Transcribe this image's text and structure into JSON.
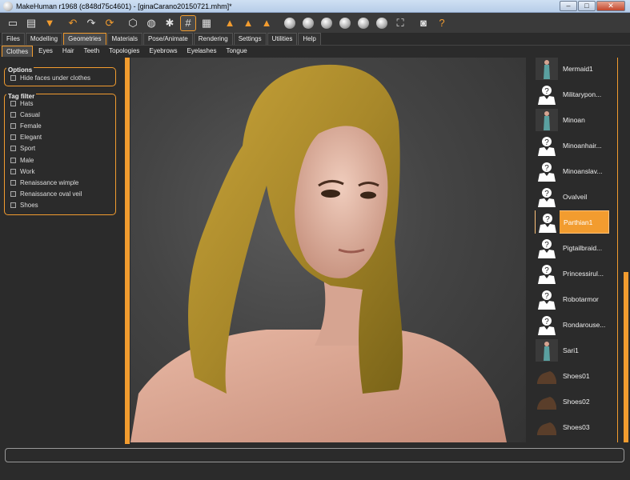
{
  "window": {
    "title": "MakeHuman r1968 (c848d75c4601) - [ginaCarano20150721.mhm]*",
    "minimize": "‒",
    "maximize": "□",
    "close": "✕"
  },
  "toolbar": {
    "icons": [
      "undo-icon",
      "redo-icon",
      "reset-icon",
      "wireframe-icon",
      "smooth-icon",
      "pose-icon",
      "grid-icon",
      "checker-icon",
      "front-view-icon",
      "back-view-icon",
      "left-view-icon",
      "right-view-icon",
      "top-view-icon",
      "bottom-view-icon",
      "reset-camera-icon",
      "screenshot-icon",
      "help-icon"
    ],
    "help_label": "?"
  },
  "menu_tabs": [
    "Files",
    "Modelling",
    "Geometries",
    "Materials",
    "Pose/Animate",
    "Rendering",
    "Settings",
    "Utilities",
    "Help"
  ],
  "active_menu_tab": "Geometries",
  "sub_tabs": [
    "Clothes",
    "Eyes",
    "Hair",
    "Teeth",
    "Topologies",
    "Eyebrows",
    "Eyelashes",
    "Tongue"
  ],
  "active_sub_tab": "Clothes",
  "options": {
    "title": "Options",
    "hide_faces": "Hide faces under clothes"
  },
  "tag_filter": {
    "title": "Tag filter",
    "tags": [
      "Hats",
      "Casual",
      "Female",
      "Elegant",
      "Sport",
      "Male",
      "Work",
      "Renaissance wimple",
      "Renaissance oval veil",
      "Shoes"
    ]
  },
  "clothes_list": [
    {
      "label": "Mermaid1",
      "thumb": "figure"
    },
    {
      "label": "Militarypon...",
      "thumb": "placeholder"
    },
    {
      "label": "Minoan",
      "thumb": "figure"
    },
    {
      "label": "Minoanhair...",
      "thumb": "placeholder"
    },
    {
      "label": "Minoanslav...",
      "thumb": "placeholder"
    },
    {
      "label": "Ovalveil",
      "thumb": "placeholder"
    },
    {
      "label": "Parthian1",
      "thumb": "placeholder",
      "selected": true
    },
    {
      "label": "Pigtailbraid...",
      "thumb": "placeholder"
    },
    {
      "label": "Princessirul...",
      "thumb": "placeholder"
    },
    {
      "label": "Robotarmor",
      "thumb": "placeholder"
    },
    {
      "label": "Rondarouse...",
      "thumb": "placeholder"
    },
    {
      "label": "Sari1",
      "thumb": "figure"
    },
    {
      "label": "Shoes01",
      "thumb": "shoe"
    },
    {
      "label": "Shoes02",
      "thumb": "shoe"
    },
    {
      "label": "Shoes03",
      "thumb": "shoe"
    }
  ],
  "colors": {
    "accent": "#f29c2f",
    "background": "#2b2b2b",
    "veil": "#b8962a"
  }
}
